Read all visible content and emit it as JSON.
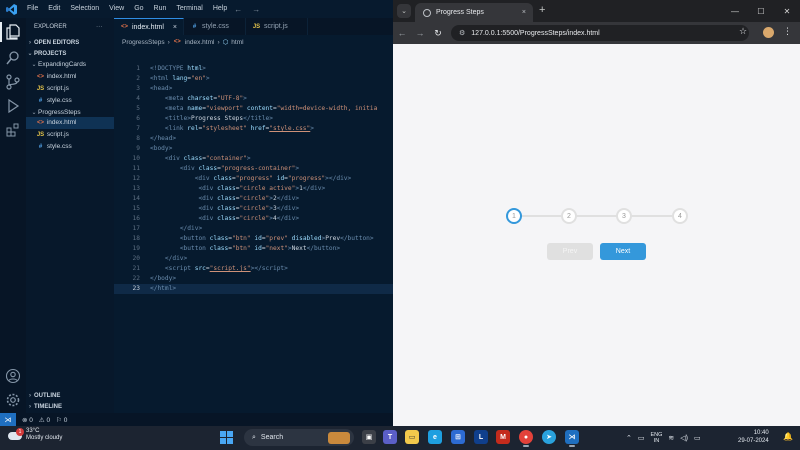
{
  "vscode": {
    "menu": [
      "File",
      "Edit",
      "Selection",
      "View",
      "Go",
      "Run",
      "Terminal",
      "Help"
    ],
    "sidebar": {
      "title": "EXPLORER",
      "open_editors": "OPEN EDITORS",
      "projects": "PROJECTS",
      "folder1": "ExpandingCards",
      "folder1_files": [
        "index.html",
        "script.js",
        "style.css"
      ],
      "folder2": "ProgressSteps",
      "folder2_files": [
        "index.html",
        "script.js",
        "style.css"
      ],
      "outline": "OUTLINE",
      "timeline": "TIMELINE"
    },
    "tabs": [
      "index.html",
      "style.css",
      "script.js"
    ],
    "breadcrumb": [
      "ProgressSteps",
      "index.html",
      "html"
    ],
    "line_numbers": [
      "1",
      "2",
      "3",
      "4",
      "5",
      "6",
      "7",
      "8",
      "9",
      "10",
      "11",
      "12",
      "13",
      "14",
      "15",
      "16",
      "17",
      "18",
      "19",
      "20",
      "21",
      "22",
      "23"
    ],
    "status": {
      "errors": "0",
      "warnings": "0",
      "info": "0"
    }
  },
  "browser": {
    "tab_title": "Progress Steps",
    "url": "127.0.0.1:5500/ProgressSteps/index.html",
    "steps": [
      "1",
      "2",
      "3",
      "4"
    ],
    "active_step": 1,
    "progress_fraction": 0,
    "prev_label": "Prev",
    "next_label": "Next",
    "colors": {
      "accent": "#3498db",
      "empty": "#e0e0e0"
    }
  },
  "taskbar": {
    "temperature": "33°C",
    "weather": "Mostly cloudy",
    "weather_badge": "1",
    "search_placeholder": "Search",
    "lang_top": "ENG",
    "lang_bottom": "IN",
    "time": "10:40",
    "date": "29-07-2024"
  }
}
